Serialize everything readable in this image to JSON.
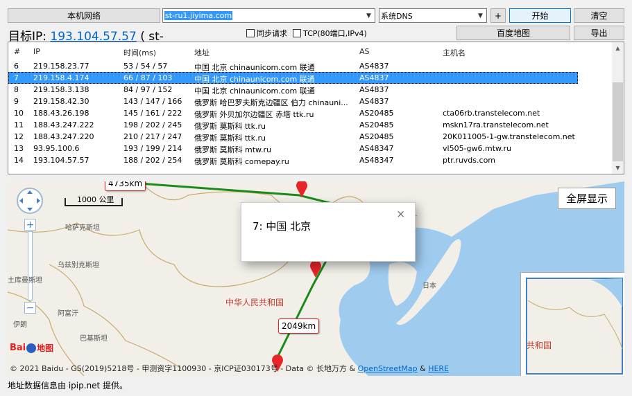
{
  "toolbar": {
    "local_network_label": "本机网络",
    "target_host": "st-ru1.jiyima.com",
    "dns_select": "系统DNS",
    "plus_label": "+",
    "start_label": "开始",
    "clear_label": "清空",
    "baidu_map_label": "百度地图",
    "export_label": "导出"
  },
  "target": {
    "prefix": "目标IP:",
    "ip": "193.104.57.57",
    "suffix": "( st-"
  },
  "options": {
    "sync_request": "同步请求",
    "tcp_mode": "TCP(80端口,IPv4)"
  },
  "table": {
    "columns": [
      "#",
      "IP",
      "时间(ms)",
      "地址",
      "AS",
      "主机名"
    ],
    "selected_row": 1,
    "rows": [
      [
        "6",
        "219.158.23.77",
        "53 / 54 / 57",
        "中国 北京 chinaunicom.com 联通",
        "AS4837",
        ""
      ],
      [
        "7",
        "219.158.4.174",
        "66 / 87 / 103",
        "中国 北京 chinaunicom.com 联通",
        "AS4837",
        ""
      ],
      [
        "8",
        "219.158.3.138",
        "84 / 97 / 152",
        "中国 北京 chinaunicom.com 联通",
        "AS4837",
        ""
      ],
      [
        "9",
        "219.158.42.30",
        "143 / 147 / 166",
        "俄罗斯 哈巴罗夫斯克边疆区 伯力 chinauni...",
        "AS4837",
        ""
      ],
      [
        "10",
        "188.43.26.198",
        "145 / 161 / 222",
        "俄罗斯 外贝加尔边疆区 赤塔 ttk.ru",
        "AS20485",
        "cta06rb.transtelecom.net"
      ],
      [
        "11",
        "188.43.247.222",
        "198 / 202 / 245",
        "俄罗斯 莫斯科 ttk.ru",
        "AS20485",
        "mskn17ra.transtelecom.net"
      ],
      [
        "12",
        "188.43.247.220",
        "210 / 217 / 247",
        "俄罗斯 莫斯科 ttk.ru",
        "AS20485",
        "20K011005-1-gw.transtelecom.net"
      ],
      [
        "13",
        "93.95.100.6",
        "193 / 199 / 214",
        "俄罗斯 莫斯科 mtw.ru",
        "AS48347",
        "vl505-gw6.mtw.ru"
      ],
      [
        "14",
        "193.104.57.57",
        "188 / 202 / 254",
        "俄罗斯 莫斯科 comepay.ru",
        "AS48347",
        "ptr.ruvds.com"
      ]
    ]
  },
  "map": {
    "distance_top": "4735km",
    "distance_bottom": "2049km",
    "scale_label": "1000 公里",
    "popup_text": "7: 中国 北京",
    "popup_close": "×",
    "fullscreen_label": "全屏显示",
    "place_labels": [
      "哈萨克斯坦",
      "乌兹别克斯坦",
      "土库曼斯坦",
      "阿富汗",
      "伊朗",
      "巴基斯坦",
      "中华人民共和国",
      "日本",
      "共和国"
    ],
    "baidu_logo_text": "Bai",
    "baidu_logo_suffix": "地图",
    "route_color": "#1a8a1a",
    "marker_color": "#e8262a",
    "copyright_prefix": "© 2021 Baidu - GS(2019)5218号 - 甲测资字1100930 - 京ICP证030173号 - Data © 长地万方 &",
    "copyright_osm": "OpenStreetMap",
    "copyright_amp": "&",
    "copyright_here": "HERE"
  },
  "footer": {
    "text": "地址数据信息由 ipip.net 提供。"
  }
}
